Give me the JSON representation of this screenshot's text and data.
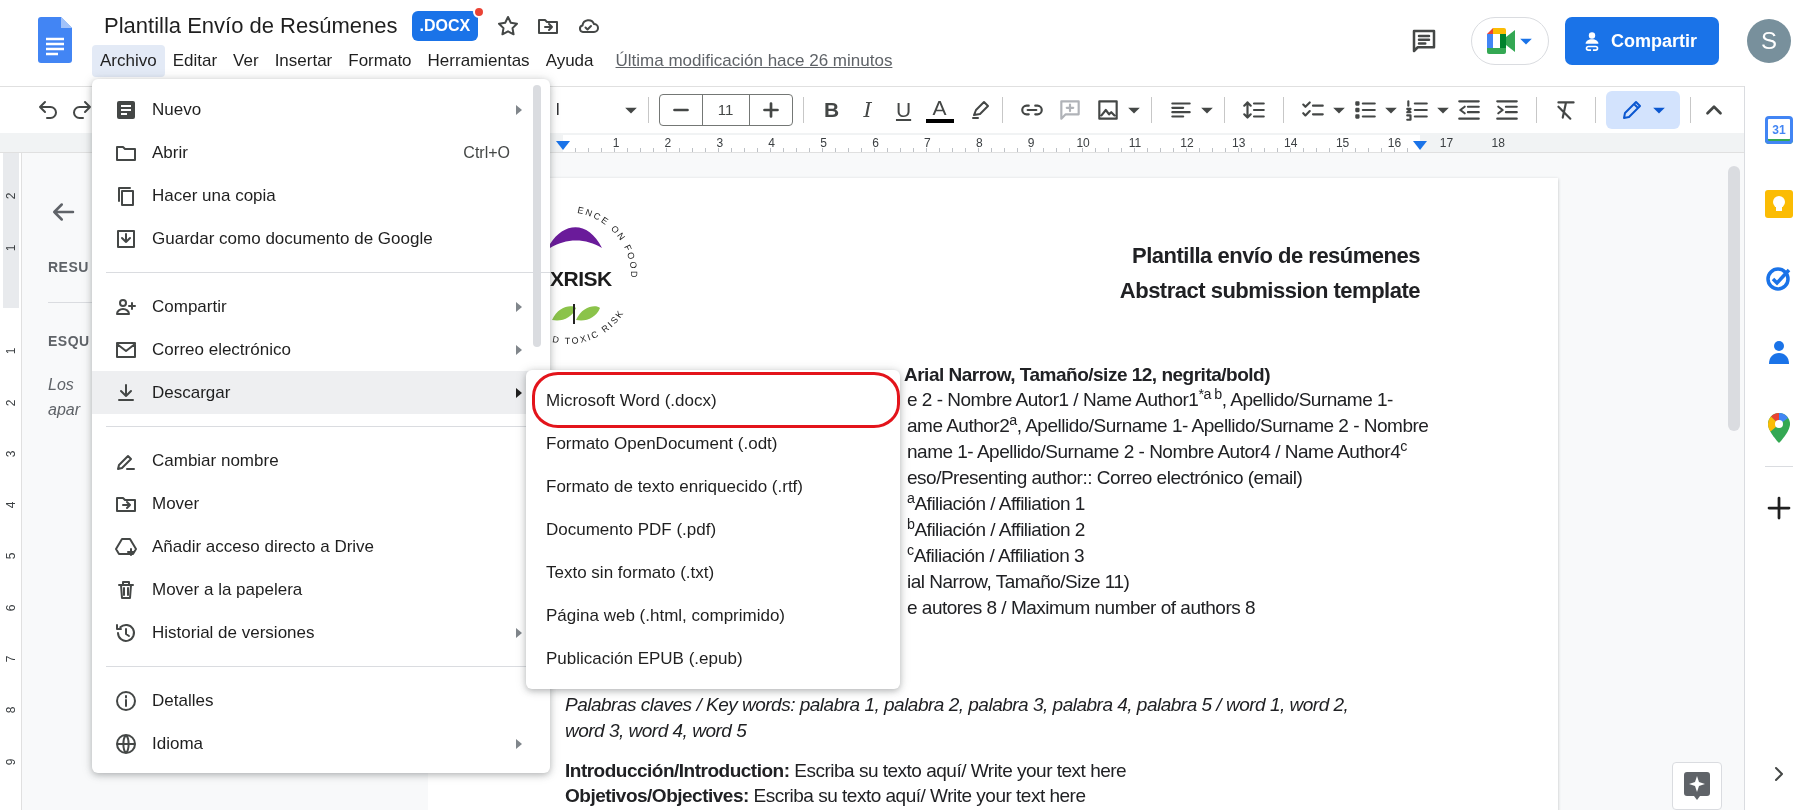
{
  "header": {
    "title": "Plantilla Envío de Resúmenes",
    "file_badge": ".DOCX",
    "badge_alert": true,
    "menus": [
      {
        "label": "Archivo",
        "selected": true
      },
      {
        "label": "Editar",
        "selected": false
      },
      {
        "label": "Ver",
        "selected": false
      },
      {
        "label": "Insertar",
        "selected": false
      },
      {
        "label": "Formato",
        "selected": false
      },
      {
        "label": "Herramientas",
        "selected": false
      },
      {
        "label": "Ayuda",
        "selected": false
      }
    ],
    "last_edit": "Última modificación hace 26 minutos",
    "share_label": "Compartir",
    "avatar_letter": "S"
  },
  "toolbar": {
    "font_name": "l",
    "font_size": "11",
    "style_buttons": [
      "B",
      "I",
      "U",
      "A"
    ]
  },
  "ruler": {
    "numbers": [
      "1",
      "2",
      "3",
      "4",
      "5",
      "6",
      "7",
      "8",
      "9",
      "10",
      "11",
      "12",
      "13",
      "14",
      "15",
      "16",
      "17",
      "18"
    ]
  },
  "vertical_ruler": {
    "numbers": [
      "2",
      "1",
      "1",
      "2",
      "3",
      "4",
      "5",
      "6",
      "7",
      "8",
      "9"
    ]
  },
  "outline": {
    "headings": [
      "RESU",
      "ESQU"
    ],
    "summary_lines": [
      "Los",
      "apar"
    ]
  },
  "document": {
    "logo": {
      "top_text": "ENCE ON FOOD",
      "name": "XRISK",
      "bottom_text": "D TOXIC RISK"
    },
    "heading": [
      "Plantilla envío de resúmenes",
      "Abstract submission template"
    ],
    "title_line": "Arial Narrow, Tamaño/size 12, negrita/bold)",
    "partial_lines": [
      "e 2 - Nombre Autor1 / Name Author1$^{*a b}$, Apellido/Surname 1-",
      "ame Author2$^{a}$, Apellido/Surname 1- Apellido/Surname 2 - Nombre",
      "name 1- Apellido/Surname 2 - Nombre Autor4 / Name Author4$^{c}$",
      "eso/Presenting author:: Correo electrónico (email)",
      "$^{a}$Afiliación / Affiliation 1",
      "$^{b}$Afiliación / Affiliation 2",
      "$^{c}$Afiliación / Affiliation 3",
      "ial Narrow, Tamaño/Size 11)",
      "e autores 8 / Maximum number of authors 8"
    ],
    "keywords_lines": [
      "Palabras claves / Key words:  palabra 1, palabra 2, palabra 3, palabra 4, palabra 5 / word 1, word 2,",
      "word 3, word 4, word 5"
    ],
    "sections": [
      "**Introducción/Introduction:** Escriba su texto aquí/ Write your text here",
      "**Objetivos/Objectives:** Escriba su texto aquí/ Write your text here"
    ]
  },
  "file_menu": {
    "sections": [
      [
        {
          "label": "Nuevo",
          "submenu": true,
          "selected": false
        },
        {
          "label": "Abrir",
          "shortcut": "Ctrl+O",
          "submenu": false,
          "selected": false
        },
        {
          "label": "Hacer una copia",
          "submenu": false,
          "selected": false
        },
        {
          "label": "Guardar como documento de Google",
          "submenu": false,
          "selected": false
        }
      ],
      [
        {
          "label": "Compartir",
          "submenu": true,
          "selected": false
        },
        {
          "label": "Correo electrónico",
          "submenu": true,
          "selected": false
        },
        {
          "label": "Descargar",
          "submenu": true,
          "selected": true
        }
      ],
      [
        {
          "label": "Cambiar nombre",
          "submenu": false,
          "selected": false
        },
        {
          "label": "Mover",
          "submenu": false,
          "selected": false
        },
        {
          "label": "Añadir acceso directo a Drive",
          "submenu": false,
          "selected": false
        },
        {
          "label": "Mover a la papelera",
          "submenu": false,
          "selected": false
        },
        {
          "label": "Historial de versiones",
          "submenu": true,
          "selected": false
        }
      ],
      [
        {
          "label": "Detalles",
          "submenu": false,
          "selected": false
        },
        {
          "label": "Idioma",
          "submenu": true,
          "selected": false
        }
      ]
    ]
  },
  "download_submenu": {
    "items": [
      {
        "label": "Microsoft Word (.docx)",
        "circled": true
      },
      {
        "label": "Formato OpenDocument (.odt)",
        "circled": false
      },
      {
        "label": "Formato de texto enriquecido (.rtf)",
        "circled": false
      },
      {
        "label": "Documento PDF (.pdf)",
        "circled": false
      },
      {
        "label": "Texto sin formato (.txt)",
        "circled": false
      },
      {
        "label": "Página web (.html, comprimido)",
        "circled": false
      },
      {
        "label": "Publicación EPUB (.epub)",
        "circled": false
      }
    ]
  },
  "side_panel": {
    "calendar_day": "31"
  }
}
